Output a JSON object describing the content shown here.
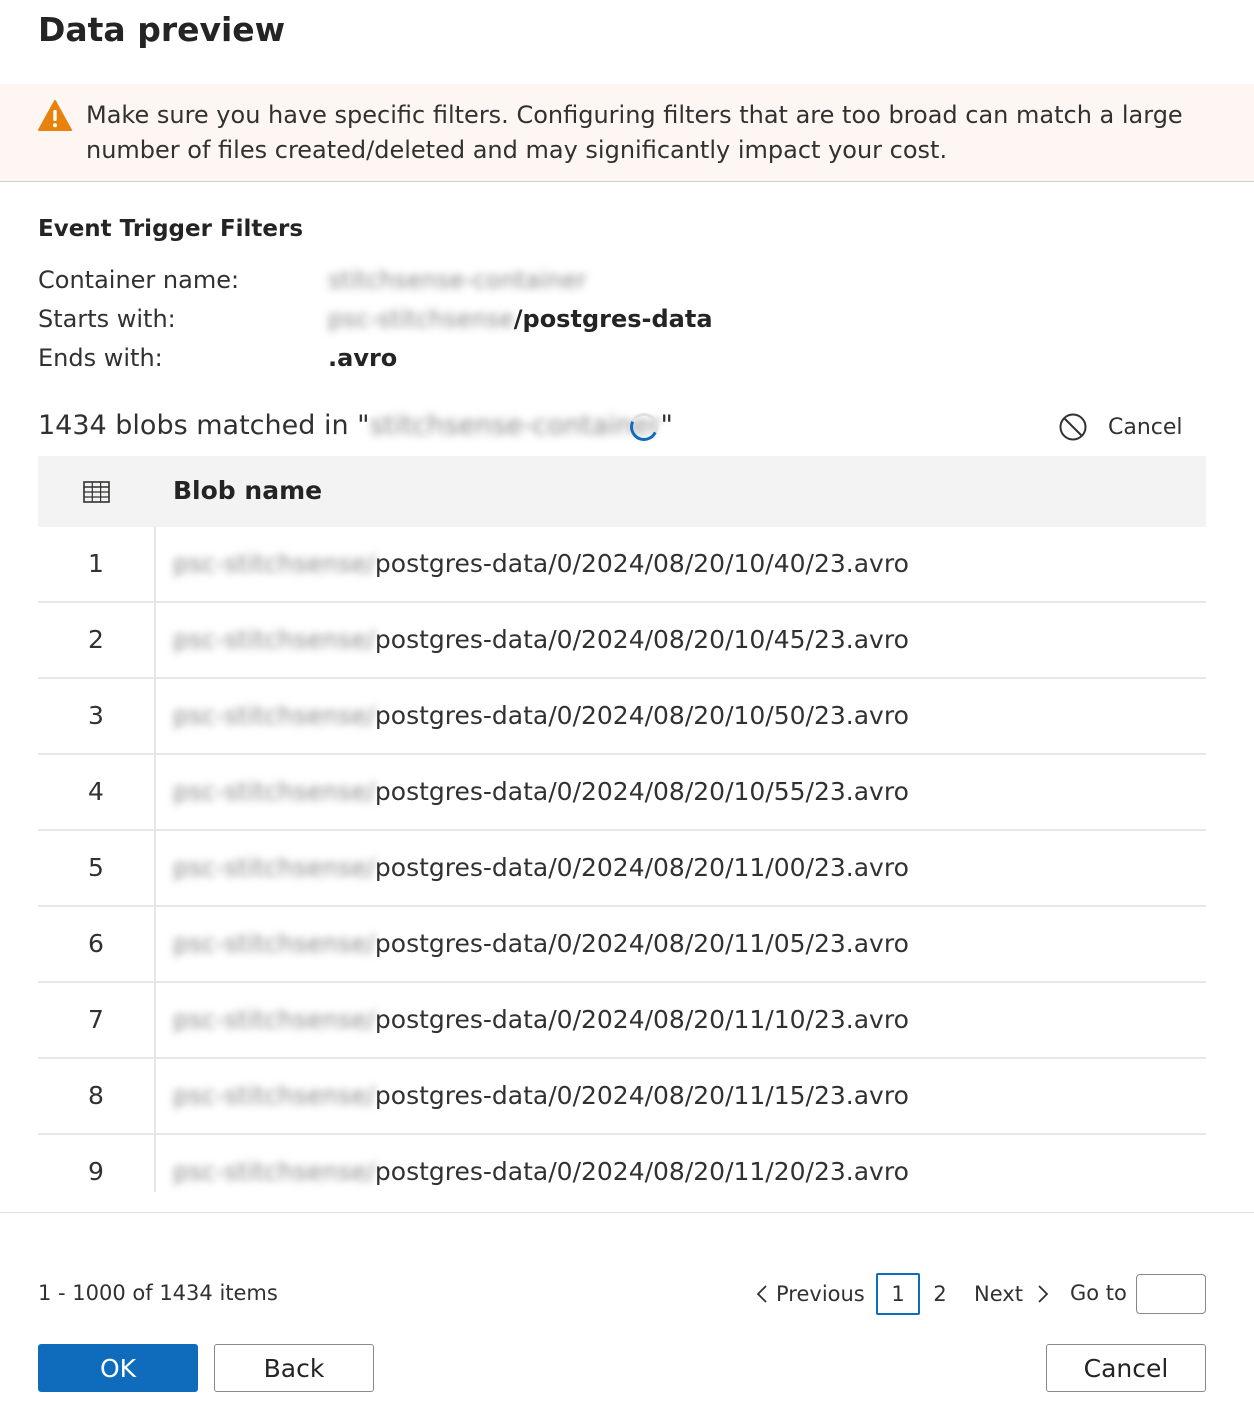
{
  "dialog": {
    "title": "Data preview",
    "warning_text": "Make sure you have specific filters. Configuring filters that are too broad can match a large number of files created/deleted and may significantly impact your cost.",
    "warning_icon": "warning-icon"
  },
  "filters": {
    "heading": "Event Trigger Filters",
    "container_label": "Container name:",
    "container_value": "stitchsense-container",
    "starts_label": "Starts with:",
    "starts_prefix": "psc-stitchsense",
    "starts_suffix": "/postgres-data",
    "ends_label": "Ends with:",
    "ends_value": ".avro"
  },
  "status": {
    "matched_prefix": "1434 blobs matched in \"",
    "matched_container": "stitchsense-container",
    "matched_suffix": "\"",
    "cancel_label": "Cancel"
  },
  "table": {
    "column_header": "Blob name",
    "blob_prefix": "psc-stitchsense/",
    "rows": [
      {
        "index": "1",
        "name": "postgres-data/0/2024/08/20/10/40/23.avro"
      },
      {
        "index": "2",
        "name": "postgres-data/0/2024/08/20/10/45/23.avro"
      },
      {
        "index": "3",
        "name": "postgres-data/0/2024/08/20/10/50/23.avro"
      },
      {
        "index": "4",
        "name": "postgres-data/0/2024/08/20/10/55/23.avro"
      },
      {
        "index": "5",
        "name": "postgres-data/0/2024/08/20/11/00/23.avro"
      },
      {
        "index": "6",
        "name": "postgres-data/0/2024/08/20/11/05/23.avro"
      },
      {
        "index": "7",
        "name": "postgres-data/0/2024/08/20/11/10/23.avro"
      },
      {
        "index": "8",
        "name": "postgres-data/0/2024/08/20/11/15/23.avro"
      },
      {
        "index": "9",
        "name": "postgres-data/0/2024/08/20/11/20/23.avro"
      }
    ]
  },
  "pagination": {
    "items_text": "1 - 1000 of 1434 items",
    "previous_label": "Previous",
    "pages": [
      "1",
      "2"
    ],
    "current_page": "1",
    "next_label": "Next",
    "goto_label": "Go to",
    "goto_value": ""
  },
  "buttons": {
    "ok": "OK",
    "back": "Back",
    "cancel": "Cancel"
  },
  "colors": {
    "primary": "#0f6cbd",
    "warning_bg": "#fdf6f3",
    "warning_icon": "#e8820c",
    "header_bg": "#f3f3f3"
  }
}
